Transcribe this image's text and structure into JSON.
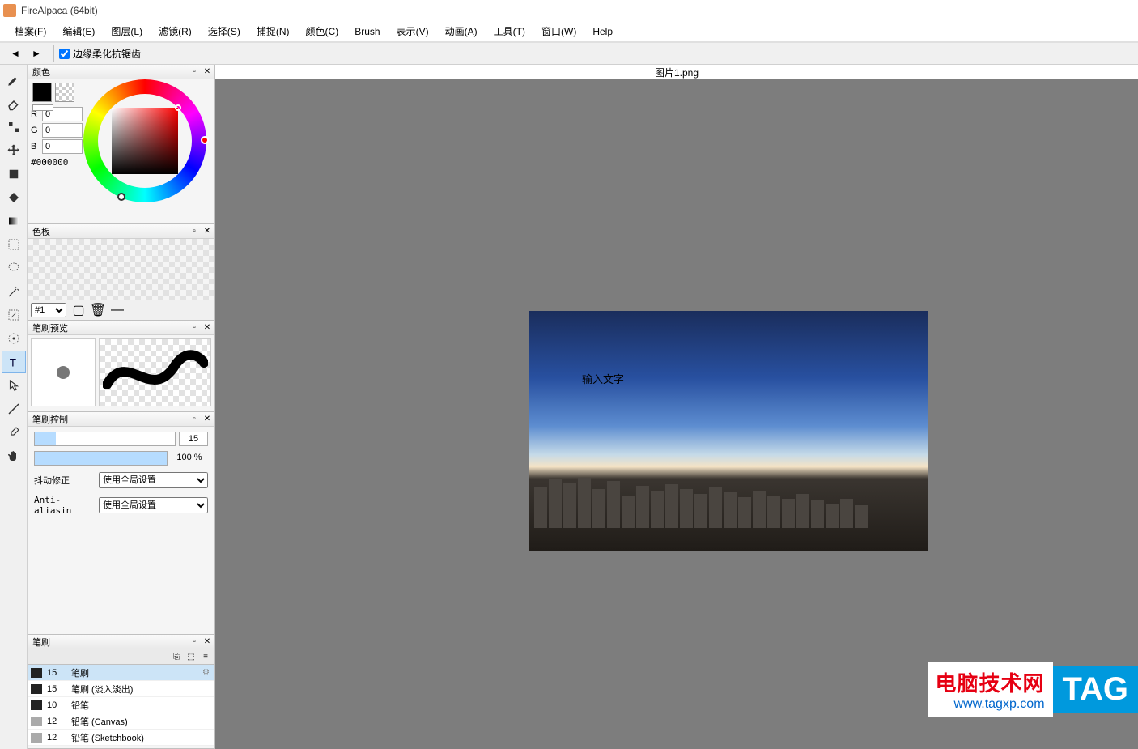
{
  "app": {
    "title": "FireAlpaca (64bit)"
  },
  "menu": [
    {
      "label": "档案",
      "key": "F"
    },
    {
      "label": "编辑",
      "key": "E"
    },
    {
      "label": "图层",
      "key": "L"
    },
    {
      "label": "滤镜",
      "key": "R"
    },
    {
      "label": "选择",
      "key": "S"
    },
    {
      "label": "捕捉",
      "key": "N"
    },
    {
      "label": "颜色",
      "key": "C"
    },
    {
      "label": "Brush",
      "key": ""
    },
    {
      "label": "表示",
      "key": "V"
    },
    {
      "label": "动画",
      "key": "A"
    },
    {
      "label": "工具",
      "key": "T"
    },
    {
      "label": "窗口",
      "key": "W"
    },
    {
      "label": "Help",
      "key": "",
      "u": "H"
    }
  ],
  "toolbar": {
    "antialias_label": "边缘柔化抗锯齿",
    "antialias_checked": true
  },
  "panels": {
    "color": {
      "title": "颜色",
      "r": "0",
      "g": "0",
      "b": "0",
      "hex": "#000000"
    },
    "palette": {
      "title": "色板",
      "select": "#1"
    },
    "brush_preview": {
      "title": "笔刷预览"
    },
    "brush_control": {
      "title": "笔刷控制",
      "size": "15",
      "size_pct": 15,
      "opacity": "100 %",
      "opacity_pct": 100,
      "jitter_label": "抖动修正",
      "jitter_value": "使用全局设置",
      "aa_label": "Anti-aliasin",
      "aa_value": "使用全局设置"
    },
    "brush_list": {
      "title": "笔刷",
      "items": [
        {
          "size": "15",
          "name": "笔刷",
          "selected": true,
          "light": false
        },
        {
          "size": "15",
          "name": "笔刷 (淡入淡出)",
          "selected": false,
          "light": false
        },
        {
          "size": "10",
          "name": "铅笔",
          "selected": false,
          "light": false
        },
        {
          "size": "12",
          "name": "铅笔 (Canvas)",
          "selected": false,
          "light": true
        },
        {
          "size": "12",
          "name": "铅笔 (Sketchbook)",
          "selected": false,
          "light": true
        }
      ]
    }
  },
  "canvas": {
    "tab": "图片1.png",
    "text_placeholder": "输入文字"
  },
  "watermark": {
    "line1": "电脑技术网",
    "line2": "www.tagxp.com",
    "tag": "TAG"
  }
}
